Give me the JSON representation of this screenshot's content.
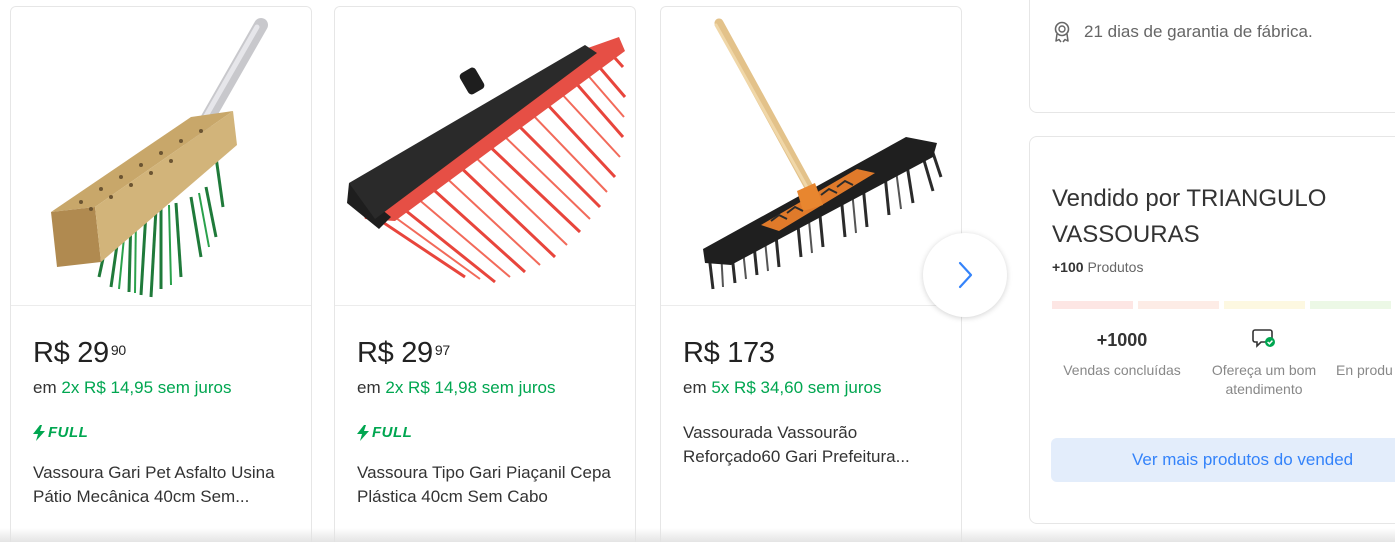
{
  "carousel": {
    "products": [
      {
        "image": "broom-wood-green-bristles",
        "price_integer": "R$ 29",
        "price_cents": "90",
        "installment_prefix": "em",
        "installment_text": "2x R$ 14,95 sem juros",
        "full_badge": "FULL",
        "title": "Vassoura Gari Pet Asfalto Usina Pátio Mecânica 40cm Sem..."
      },
      {
        "image": "broom-red-bristles",
        "price_integer": "R$ 29",
        "price_cents": "97",
        "installment_prefix": "em",
        "installment_text": "2x R$ 14,98 sem juros",
        "full_badge": "FULL",
        "title": "Vassoura Tipo Gari Piaçanil Cepa Plástica 40cm Sem Cabo"
      },
      {
        "image": "push-broom-black-bristles",
        "price_integer": "R$ 173",
        "price_cents": "",
        "installment_prefix": "em",
        "installment_text": "5x R$ 34,60 sem juros",
        "full_badge": "",
        "title": "Vassourada Vassourão Reforçado60 Gari Prefeitura..."
      }
    ],
    "next_icon": "chevron-right-icon"
  },
  "warranty": {
    "icon": "medal-icon",
    "text": "21 dias de garantia de fábrica."
  },
  "seller": {
    "title": "Vendido por TRIANGULO VASSOURAS",
    "products_count": "+100",
    "products_label": "Produtos",
    "thermometer_colors": [
      "#fde8e8",
      "#fdeeea",
      "#fefbe5",
      "#eef9e9"
    ],
    "metrics": [
      {
        "value": "+1000",
        "label": "Vendas concluídas"
      },
      {
        "value": "",
        "label": "Ofereça um bom atendimento",
        "icon": "message-check-icon"
      },
      {
        "value": "",
        "label": "En produ"
      }
    ],
    "see_more": "Ver mais produtos do vended"
  },
  "colors": {
    "green": "#00a650",
    "blue": "#3483fa",
    "button_bg": "#e3edfb"
  }
}
